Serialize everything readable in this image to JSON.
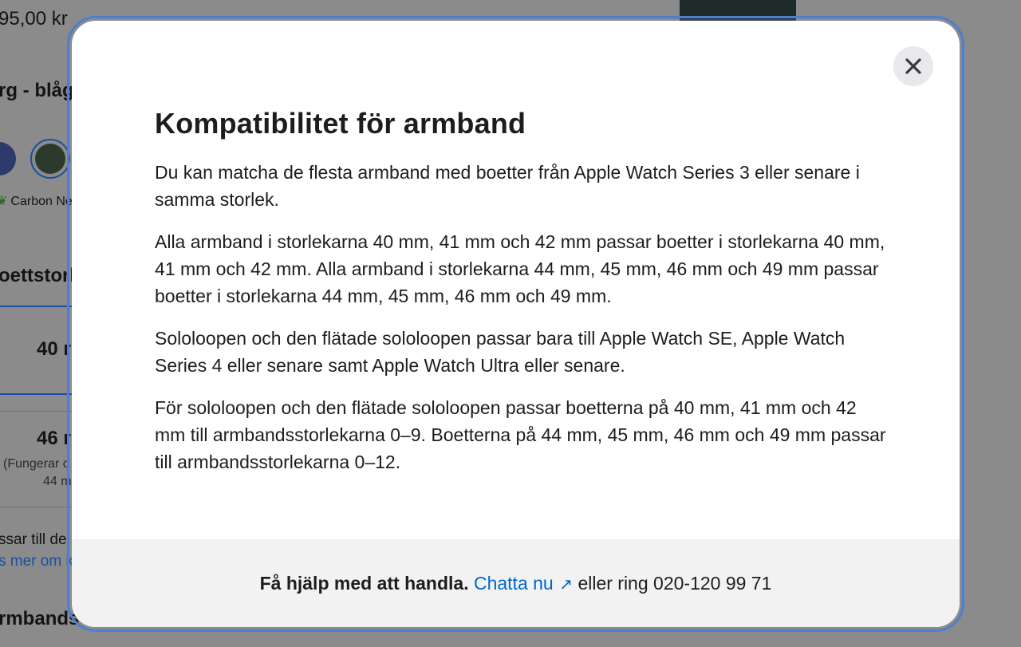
{
  "background": {
    "price": "95,00 kr",
    "color_label": "rg - blåg",
    "carbon_label": "Carbon Ne",
    "size_heading": "oettstorl",
    "size_40": "40 r",
    "size_46": "46 r",
    "works_line_1": "(Fungerar o",
    "works_line_2": "44 m",
    "fits_text": "ssar till de",
    "read_more": "s mer om k",
    "band_heading": "rmbands"
  },
  "modal": {
    "title": "Kompatibilitet för armband",
    "paragraphs": [
      "Du kan matcha de flesta armband med boetter från Apple Watch Series 3 eller senare i samma storlek.",
      "Alla armband i storlekarna 40 mm, 41 mm och 42 mm passar boetter i storlekarna 40 mm, 41 mm och 42 mm. Alla armband i storlekarna 44 mm, 45 mm, 46 mm och 49 mm passar boetter i storlekarna 44 mm, 45 mm, 46 mm och 49 mm.",
      "Sololoopen och den flätade sololoopen passar bara till Apple Watch SE, Apple Watch Series 4 eller senare samt Apple Watch Ultra eller senare.",
      "För sololoopen och den flätade sololoopen passar boetterna på 40 mm, 41 mm och 42 mm till armbandsstorlekarna 0–9. Boetterna på 44 mm, 45 mm, 46 mm och 49 mm passar till armbandsstorlekarna 0–12."
    ],
    "close_icon": "close-icon"
  },
  "footer": {
    "help_text": "Få hjälp med att handla.",
    "chat_link": "Chatta nu",
    "chat_icon": "external-arrow-icon",
    "call_text": "eller ring 020-120 99 71"
  },
  "colors": {
    "link": "#0066cc",
    "focus_ring": "#4d7fd0",
    "overlay": "#8b8b8b",
    "footer_bg": "#f2f2f2"
  }
}
